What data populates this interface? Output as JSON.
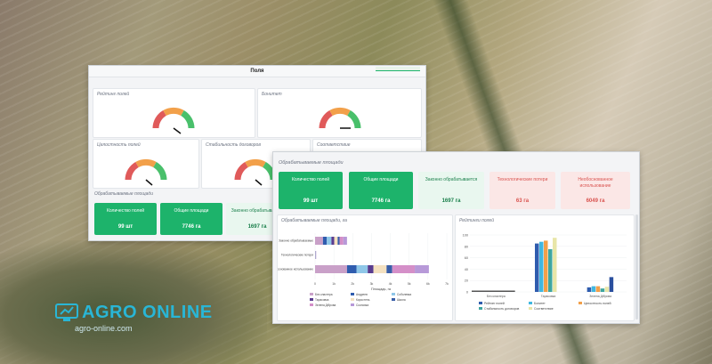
{
  "back_panel": {
    "title": "Поля",
    "cards": {
      "rating": "Рейтинг полей",
      "budget": "Бонитет",
      "integrity": "Целостность полей",
      "stability": "Стабильность договоров",
      "compliance": "Соответствие"
    },
    "areas_title": "Обрабатываемые площади",
    "kpis": [
      {
        "label": "Количество полей",
        "value": "99 шт"
      },
      {
        "label": "Общие площади",
        "value": "7746 га"
      },
      {
        "label": "Законно обрабатывается",
        "value": "1697 га"
      }
    ]
  },
  "front_panel": {
    "areas_title": "Обрабатываемые площади",
    "kpis": [
      {
        "label": "Количество полей",
        "value": "99 шт",
        "style": "green"
      },
      {
        "label": "Общие площади",
        "value": "7746 га",
        "style": "green"
      },
      {
        "label": "Законно обрабатывается",
        "value": "1697 га",
        "style": "lgreen"
      },
      {
        "label": "Технологические потери",
        "value": "63 га",
        "style": "lpink"
      },
      {
        "label": "Необоснованное использование",
        "value": "6049 га",
        "style": "lpink"
      }
    ],
    "bar_chart_title": "Обрабатываемые площади, га",
    "rating_chart_title": "Рейтинги полей"
  },
  "chart_data": [
    {
      "type": "bar",
      "orientation": "horizontal",
      "stacked": true,
      "title": "Обрабатываемые площади, га",
      "xlabel": "Площадь, га",
      "categories": [
        "Законно обрабатываемые",
        "Технологические потери",
        "Необоснованное использование"
      ],
      "x_ticks": [
        "0",
        "1k",
        "2k",
        "3k",
        "4k",
        "5k",
        "6k",
        "7k"
      ],
      "xlim": [
        0,
        7000
      ],
      "series": [
        {
          "name": "Без кластера",
          "color": "#c9a0c8",
          "values": [
            420,
            20,
            1700
          ]
        },
        {
          "name": "Андреев",
          "color": "#2f5cae",
          "values": [
            200,
            10,
            500
          ]
        },
        {
          "name": "Соболевка",
          "color": "#8fc7e8",
          "values": [
            250,
            10,
            600
          ]
        },
        {
          "name": "Тарасовка",
          "color": "#5a3c8f",
          "values": [
            150,
            5,
            300
          ]
        },
        {
          "name": "Коростень",
          "color": "#f4e1c0",
          "values": [
            180,
            5,
            700
          ]
        },
        {
          "name": "Школа",
          "color": "#3a5fa8",
          "values": [
            100,
            3,
            300
          ]
        },
        {
          "name": "Зелена Діброва",
          "color": "#d48fc8",
          "values": [
            200,
            5,
            1200
          ]
        },
        {
          "name": "Сосновка",
          "color": "#b799d8",
          "values": [
            197,
            5,
            749
          ]
        }
      ]
    },
    {
      "type": "bar",
      "title": "Рейтинги полей",
      "categories": [
        "Без кластера",
        "Тарасовка",
        "Зелена Діброва"
      ],
      "y_ticks": [
        "0",
        "20",
        "40",
        "60",
        "80",
        "100"
      ],
      "ylim": [
        0,
        100
      ],
      "series": [
        {
          "name": "Рейтинг полей",
          "color": "#2f5cae",
          "values": [
            0,
            85,
            8
          ]
        },
        {
          "name": "Бонитет",
          "color": "#40b7e0",
          "values": [
            0,
            88,
            10
          ]
        },
        {
          "name": "Целостность полей",
          "color": "#f2a04a",
          "values": [
            0,
            90,
            10
          ]
        },
        {
          "name": "Стабильность договоров",
          "color": "#3ea6a0",
          "values": [
            0,
            75,
            6
          ]
        },
        {
          "name": "Соответствие",
          "color": "#e8e6a8",
          "values": [
            2,
            95,
            9
          ]
        },
        {
          "name": "Прочее",
          "color": "#2a4f9e",
          "values": [
            0,
            0,
            26
          ]
        }
      ],
      "legend_items": [
        "Рейтинг полей",
        "Бонитет",
        "Целостность полей",
        "Стабильность договоров",
        "Соответствие"
      ]
    }
  ],
  "brand": {
    "name": "AGRO ONLINE",
    "url": "agro-online.com",
    "accent": "#29b6d6"
  }
}
